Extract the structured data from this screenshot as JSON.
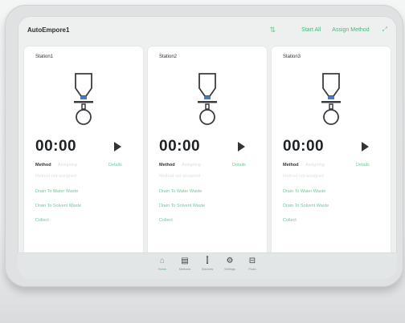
{
  "header": {
    "title": "AutoEmpore1",
    "start_all": "Start All",
    "assign_method": "Assign Method",
    "filter_icon": "filter-icon",
    "expand_icon": "expand-icon"
  },
  "stations": [
    {
      "name": "Station1",
      "timer": "00:00",
      "method_label": "Method",
      "method_value": "Assigning",
      "details": "Details",
      "hint": "Method not assigned",
      "actions": [
        "Drain To Water Waste",
        "Drain To Solvent Waste",
        "Collect"
      ]
    },
    {
      "name": "Station2",
      "timer": "00:00",
      "method_label": "Method",
      "method_value": "Assigning",
      "details": "Details",
      "hint": "Method not assigned",
      "actions": [
        "Drain To Water Waste",
        "Drain To Solvent Waste",
        "Collect"
      ]
    },
    {
      "name": "Station3",
      "timer": "00:00",
      "method_label": "Method",
      "method_value": "Assigning",
      "details": "Details",
      "hint": "Method not assigned",
      "actions": [
        "Drain To Water Waste",
        "Drain To Solvent Waste",
        "Collect"
      ]
    }
  ],
  "nav": [
    {
      "label": "Home",
      "icon": "home-icon",
      "active": true
    },
    {
      "label": "Methods",
      "icon": "methods-icon",
      "active": false
    },
    {
      "label": "Solvents",
      "icon": "solvents-icon",
      "active": false
    },
    {
      "label": "Settings",
      "icon": "settings-icon",
      "active": false
    },
    {
      "label": "Flush",
      "icon": "flush-icon",
      "active": false
    }
  ],
  "colors": {
    "accent": "#4bb47a",
    "frame": "#dfe1e2",
    "screen": "#eef0f0"
  }
}
